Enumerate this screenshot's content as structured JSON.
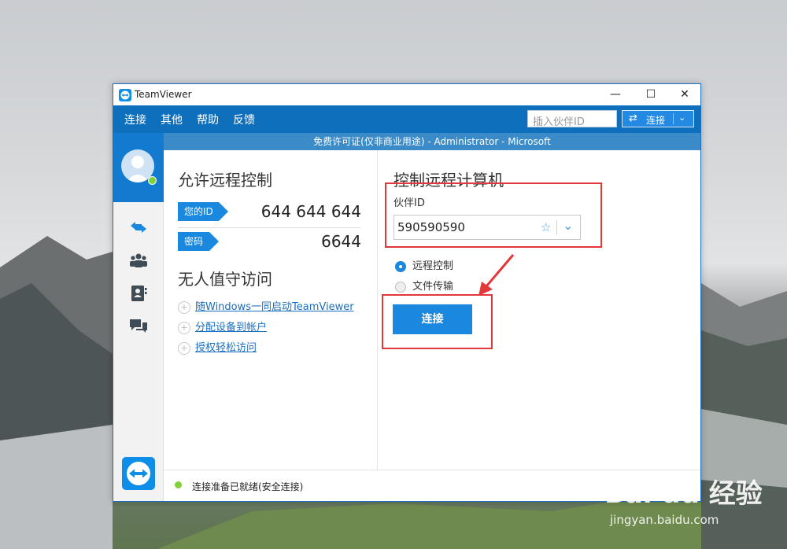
{
  "window": {
    "title": "TeamViewer"
  },
  "window_controls": {
    "minimize": "—",
    "maximize": "☐",
    "close": "✕"
  },
  "menu": {
    "items": [
      "连接",
      "其他",
      "帮助",
      "反馈"
    ]
  },
  "toolbar": {
    "partner_id_placeholder": "插入伙伴ID",
    "connect_label": "连接"
  },
  "banner": {
    "text": "免费许可证(仅非商业用途) - Administrator - Microsoft"
  },
  "allow_remote": {
    "title": "允许远程控制",
    "id_label": "您的ID",
    "id_value": "644 644 644",
    "password_label": "密码",
    "password_value": "6644"
  },
  "unattended": {
    "title": "无人值守访问",
    "links": [
      "随Windows一同启动TeamViewer",
      "分配设备到帐户",
      "授权轻松访问"
    ]
  },
  "control_remote": {
    "title": "控制远程计算机",
    "partner_id_label": "伙伴ID",
    "partner_id_value": "590590590",
    "options": [
      "远程控制",
      "文件传输"
    ],
    "selected_option": "远程控制",
    "connect_button": "连接"
  },
  "status": {
    "text": "连接准备已就绪(安全连接)",
    "color": "#7ed13a"
  },
  "watermark": {
    "brand": "Bai du 经验",
    "url": "jingyan.baidu.com"
  },
  "colors": {
    "accent": "#1a88de",
    "menubar": "#0e6fbd",
    "banner": "#3a8bc7",
    "highlight": "#e3383a"
  }
}
